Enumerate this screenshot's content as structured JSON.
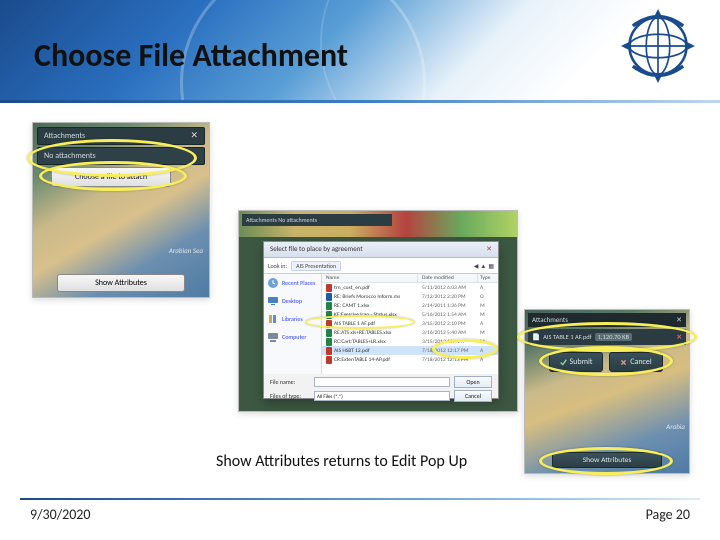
{
  "header": {
    "title": "Choose File Attachment"
  },
  "caption": "Show Attributes returns to Edit Pop Up",
  "footer": {
    "date": "9/30/2020",
    "page": "Page 20"
  },
  "shot1": {
    "header": "Attachments",
    "no_attachments": "No attachments",
    "choose_label": "Choose a file to attach",
    "show_attributes": "Show Attributes",
    "sea_label": "Arabian Sea"
  },
  "shot2": {
    "panel_header": "Attachments   No attachments",
    "dialog_title": "Select file to place by agreement",
    "look_in_label": "Look in:",
    "folder": "AIS Presentation",
    "sidebar": [
      "Recent Places",
      "Desktop",
      "Libraries",
      "Computer"
    ],
    "columns": [
      "Name",
      "Date modified",
      "Type"
    ],
    "files": [
      {
        "ico": "pdf",
        "name": "trn_cost_en.pdf",
        "date": "5/11/2012 6:03 AM",
        "type": "A"
      },
      {
        "ico": "doc",
        "name": "RE: Briefs Morocco Inform.ms",
        "date": "7/12/2012 2:20 PM",
        "type": "O"
      },
      {
        "ico": "xls",
        "name": "RE: CAMT 1.xlsx",
        "date": "2/14/2011 1:36 PM",
        "type": "M"
      },
      {
        "ico": "xls",
        "name": "KE:Exercise lcao - Status.xlsx",
        "date": "5/16/2012 1:54 AM",
        "type": "M"
      },
      {
        "ico": "pdf",
        "name": "AIS TABLE 1 AF.pdf",
        "date": "3/15/2012 2:10 PM",
        "type": "A"
      },
      {
        "ico": "xls",
        "name": "RE:ATS xls+RE:TABLES.xlsx",
        "date": "3/16/2012 5:40 AM",
        "type": "M"
      },
      {
        "ico": "xls",
        "name": "RC:Cart:TABLES+LR.xlsx",
        "date": "3/15/2012 11:41 A",
        "type": "M"
      },
      {
        "ico": "pdf",
        "name": "AIS HSBT 12.pdf",
        "date": "7/18/2012 12:17 PM",
        "type": "A"
      },
      {
        "ico": "pdf",
        "name": "CR:ExtenTABLE 14-AP.pdf",
        "date": "7/18/2012 12:13 PM",
        "type": "A"
      }
    ],
    "selected_index": 7,
    "filename_label": "File name:",
    "filetype_label": "Files of type:",
    "filetype_value": "All Files (*.*)",
    "open_label": "Open",
    "cancel_label": "Cancel"
  },
  "shot3": {
    "header": "Attachments",
    "file_name": "AIS TABLE 1 AF.pdf",
    "file_size": "1,120.70 KB",
    "submit_label": "Submit",
    "cancel_label": "Cancel",
    "show_attributes": "Show Attributes",
    "sea_label": "Arabia"
  }
}
